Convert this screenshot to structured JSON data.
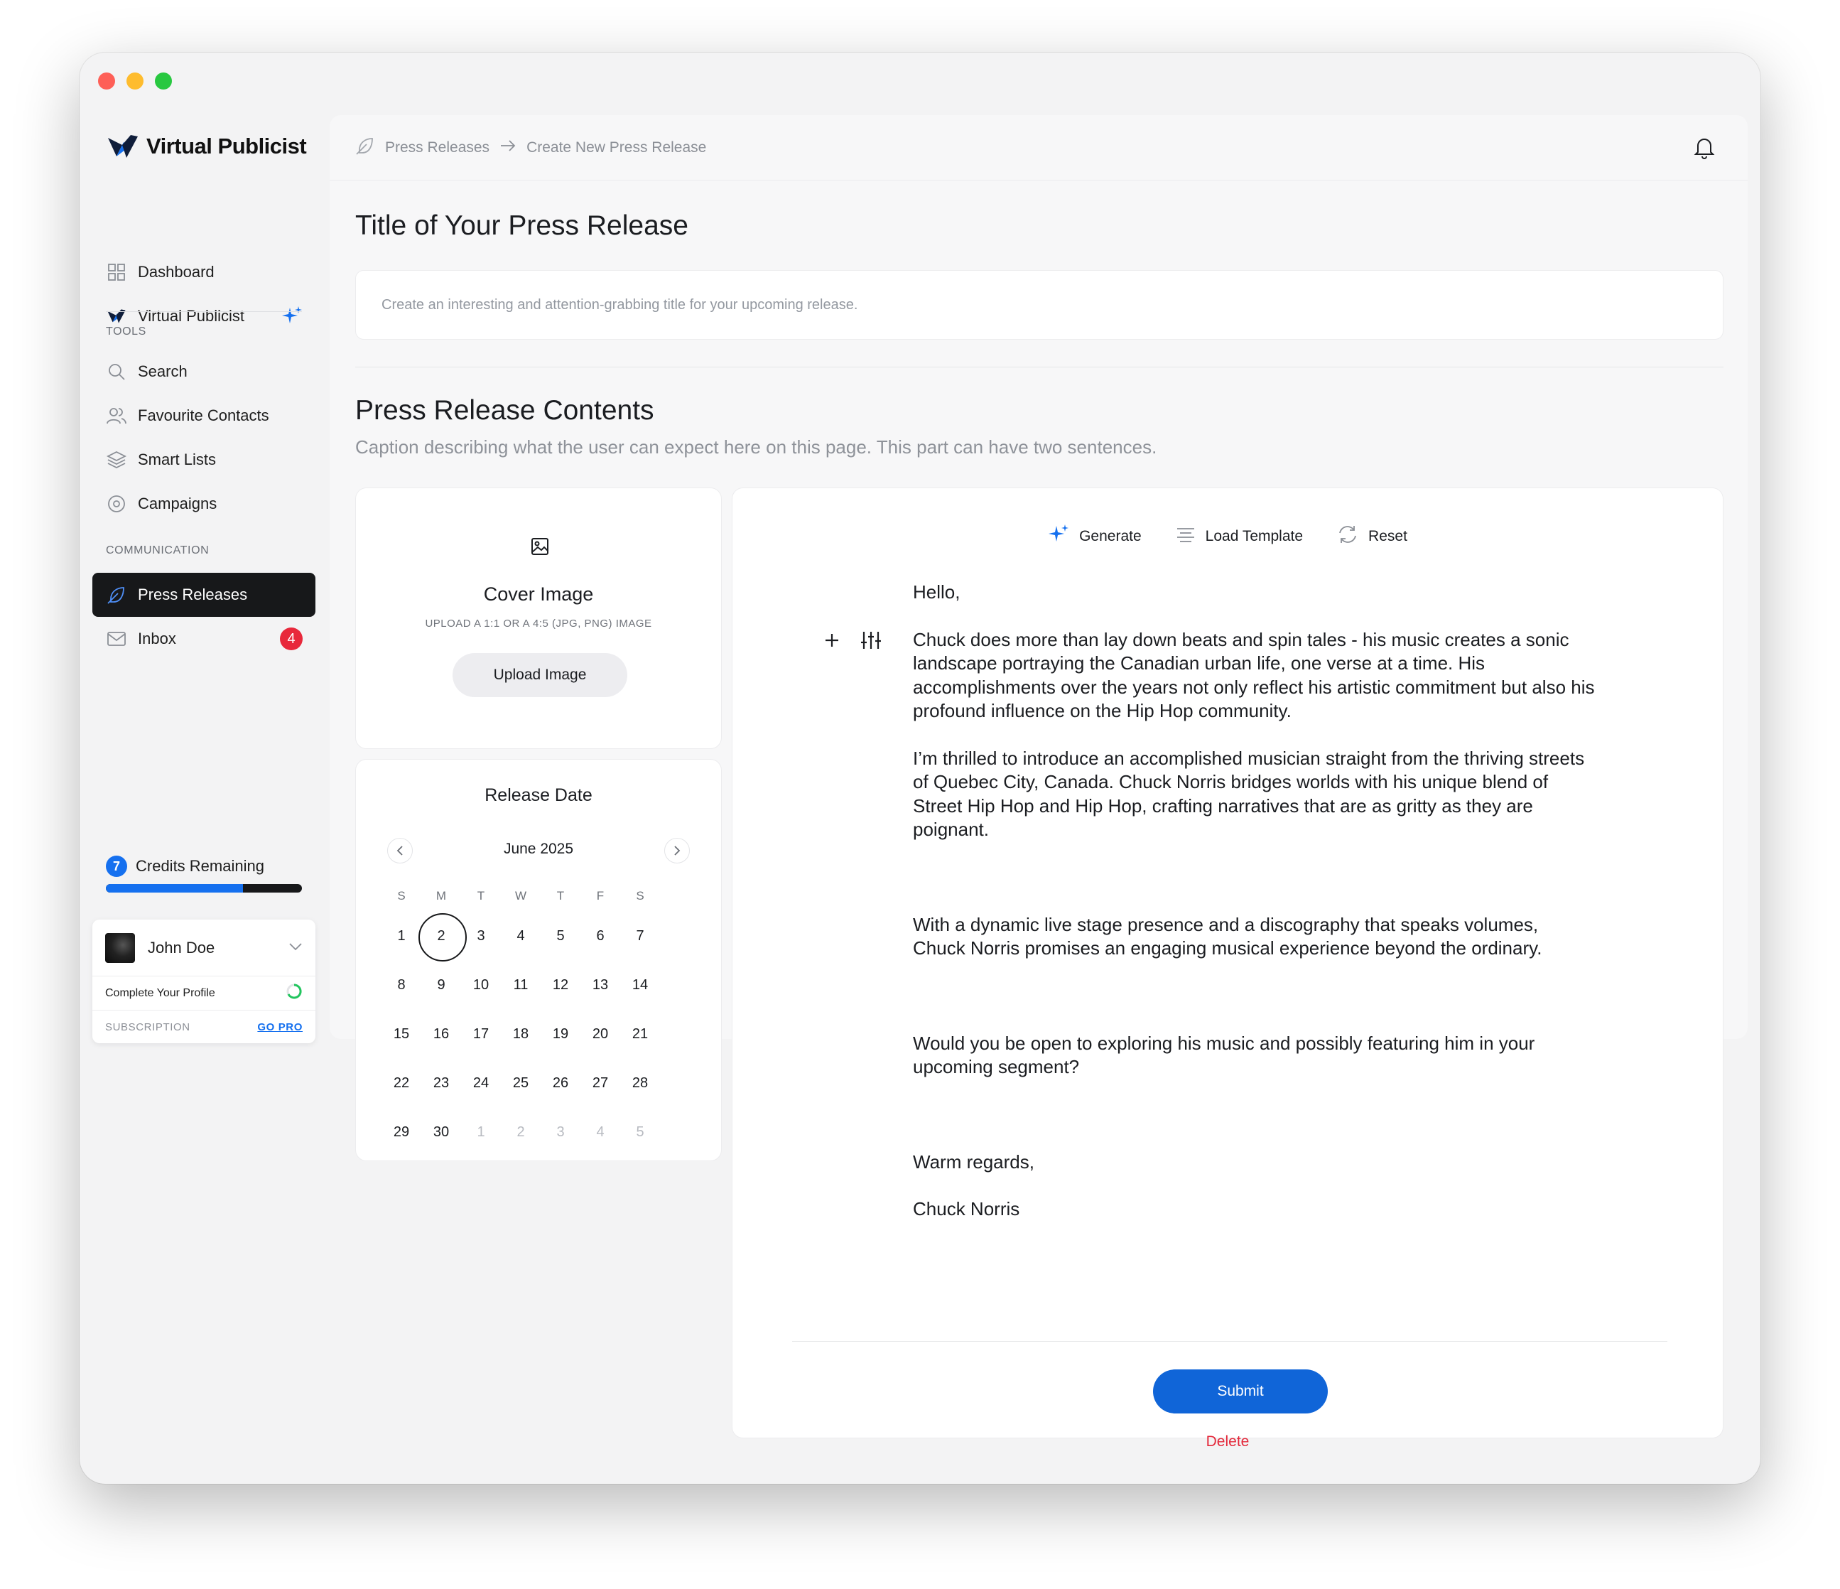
{
  "brand": {
    "name": "Virtual Publicist"
  },
  "sidebar": {
    "items": [
      {
        "label": "Dashboard",
        "icon": "grid-icon"
      },
      {
        "label": "Virtual Publicist",
        "icon": "logo-icon"
      }
    ],
    "tools_label": "TOOLS",
    "tools": [
      {
        "label": "Search",
        "icon": "search-icon"
      },
      {
        "label": "Favourite Contacts",
        "icon": "users-icon"
      },
      {
        "label": "Smart Lists",
        "icon": "layers-icon"
      },
      {
        "label": "Campaigns",
        "icon": "target-icon"
      }
    ],
    "communication_label": "COMMUNICATION",
    "communication": [
      {
        "label": "Press Releases",
        "icon": "feather-icon",
        "active": true
      },
      {
        "label": "Inbox",
        "icon": "mail-icon",
        "badge": "4"
      }
    ],
    "credits": {
      "count": "7",
      "label": "Credits Remaining",
      "fill_fraction": 0.7
    },
    "profile": {
      "name": "John Doe",
      "complete_label": "Complete Your Profile",
      "subscription_label": "SUBSCRIPTION",
      "go_pro_label": "GO PRO"
    }
  },
  "breadcrumb": {
    "root": "Press Releases",
    "current": "Create New Press Release"
  },
  "page": {
    "title_heading": "Title of Your Press Release",
    "title_placeholder": "Create an interesting and attention-grabbing title for your upcoming release.",
    "contents_heading": "Press Release Contents",
    "caption": "Caption describing what the user can expect here on this page. This part can have two sentences."
  },
  "cover": {
    "title": "Cover Image",
    "subtitle": "UPLOAD A 1:1 OR A 4:5 (JPG, PNG) IMAGE",
    "button": "Upload Image"
  },
  "release_date": {
    "title": "Release Date",
    "month": "June 2025",
    "weekdays": [
      "S",
      "M",
      "T",
      "W",
      "T",
      "F",
      "S"
    ],
    "days": [
      "1",
      "2",
      "3",
      "4",
      "5",
      "6",
      "7",
      "8",
      "9",
      "10",
      "11",
      "12",
      "13",
      "14",
      "15",
      "16",
      "17",
      "18",
      "19",
      "20",
      "21",
      "22",
      "23",
      "24",
      "25",
      "26",
      "27",
      "28",
      "29",
      "30"
    ],
    "trailing_days": [
      "1",
      "2",
      "3",
      "4",
      "5"
    ],
    "selected": "2"
  },
  "editor": {
    "toolbar": {
      "generate": "Generate",
      "load_template": "Load Template",
      "reset": "Reset"
    },
    "paragraphs": [
      "Hello,",
      "Chuck does more than lay down beats and spin tales - his music creates a sonic landscape portraying the Canadian urban life, one verse at a time. His accomplishments over the years not only reflect his artistic commitment but also his profound influence on the Hip Hop community.",
      "I’m thrilled to introduce an accomplished musician straight from the thriving streets of Quebec City, Canada. Chuck Norris bridges worlds with his unique blend of Street Hip Hop and Hip Hop, crafting narratives that are as gritty as they are poignant.",
      "With a dynamic live stage presence and a discography that speaks volumes, Chuck Norris promises an engaging musical experience beyond the ordinary.",
      "Would you be open to exploring his music and possibly featuring him in your upcoming segment?",
      "Warm regards,",
      "Chuck Norris"
    ],
    "submit": "Submit",
    "delete": "Delete"
  },
  "colors": {
    "accent": "#1570ef",
    "danger": "#e4283a",
    "active_nav": "#17181a"
  }
}
